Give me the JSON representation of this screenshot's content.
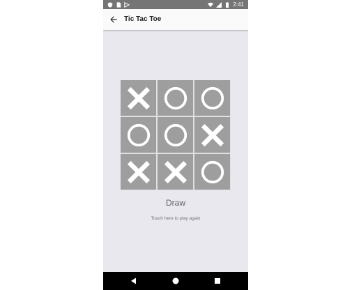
{
  "status_bar": {
    "time": "2:41",
    "left_icons": [
      "shield-icon",
      "sim-card-icon",
      "cast-icon"
    ],
    "right_icons": [
      "wifi-icon",
      "signal-icon",
      "battery-icon"
    ]
  },
  "app_bar": {
    "back_icon": "arrow-left-icon",
    "title": "Tic Tac Toe"
  },
  "board": {
    "cells": [
      "X",
      "O",
      "O",
      "O",
      "O",
      "X",
      "X",
      "X",
      "O"
    ],
    "colors": {
      "cell": "#9e9e9e",
      "mark": "#ffffff",
      "grid": "#e0e0e0"
    }
  },
  "result_text": "Draw",
  "hint_text": "Touch here to play again",
  "nav_bar": {
    "buttons": [
      "back-triangle-icon",
      "home-circle-icon",
      "recents-square-icon"
    ]
  },
  "colors": {
    "background": "#e8e8ee",
    "status_bar": "#757575",
    "app_bar": "#fafafa",
    "nav_bar": "#000000"
  }
}
